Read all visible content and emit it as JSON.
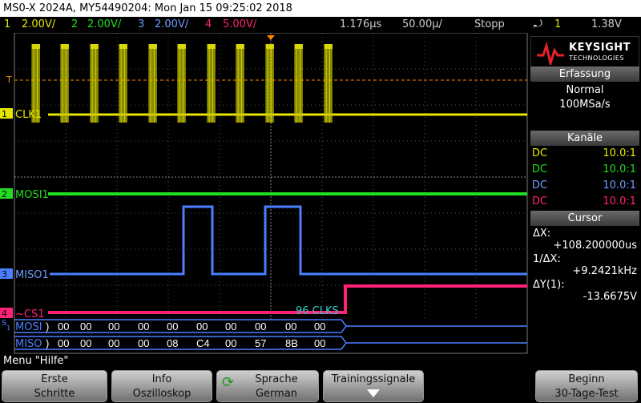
{
  "title": "MS0-X 2024A, MY54490204: Mon Jan 15 09:25:02 2018",
  "status": {
    "ch1_num": "1",
    "ch1_scale": "2.00V/",
    "ch2_num": "2",
    "ch2_scale": "2.00V/",
    "ch3_num": "3",
    "ch3_scale": "2.00V/",
    "ch4_num": "4",
    "ch4_scale": "5.00V/",
    "time_pos": "1.176μs",
    "time_base": "50.00μ/",
    "run_state": "Stopp",
    "trigger_icon": "trigger-edge-icon",
    "trigger_ch": "1",
    "trigger_level": "1.38V"
  },
  "colors": {
    "ch1": "#e6e600",
    "ch2": "#22dd22",
    "ch3": "#4a7fff",
    "ch4": "#ff2277",
    "decode": "#33cccc"
  },
  "waveforms": {
    "ch1_label": "CLK1",
    "ch2_label": "MOSI1",
    "ch3_label": "MISO1",
    "ch4_label": "~CS1",
    "marker_1": "1",
    "marker_2": "2",
    "marker_3": "3",
    "marker_4": "4",
    "trig_marker": "T",
    "decode_count": "96 CLKS",
    "bus_mosi_label": "MOSI",
    "bus_miso_label": "MISO",
    "bus_s": "S",
    "bus_1": "1",
    "mosi_values": [
      ")",
      "00",
      "00",
      "00",
      "00",
      "00",
      "00",
      "00",
      "00",
      "00",
      "00"
    ],
    "miso_values": [
      ")",
      "00",
      "00",
      "00",
      "00",
      "08",
      "C4",
      "00",
      "57",
      "8B",
      "00"
    ]
  },
  "panel": {
    "brand": "KEYSIGHT",
    "brand_sub": "TECHNOLOGIES",
    "acq_title": "Erfassung",
    "acq_mode": "Normal",
    "acq_rate": "100MSa/s",
    "channels_title": "Kanäle",
    "channels": [
      {
        "coupling": "DC",
        "probe": "10.0:1"
      },
      {
        "coupling": "DC",
        "probe": "10.0:1"
      },
      {
        "coupling": "DC",
        "probe": "10.0:1"
      },
      {
        "coupling": "DC",
        "probe": "10.0:1"
      }
    ],
    "cursor_title": "Cursor",
    "dx_label": "ΔX:",
    "dx_value": "+108.200000us",
    "inv_dx_label": "1/ΔX:",
    "inv_dx_value": "+9.2421kHz",
    "dy_label": "ΔY(1):",
    "dy_value": "-13.6675V"
  },
  "menu": {
    "label": "Menu \"Hilfe\"",
    "keys": [
      {
        "line1": "Erste",
        "line2": "Schritte"
      },
      {
        "line1": "Info",
        "line2": "Oszilloskop"
      },
      {
        "line1": "Sprache",
        "line2": "German"
      },
      {
        "line1": "Trainingssignale",
        "line2": ""
      },
      {
        "line1": "Beginn",
        "line2": "30-Tage-Test"
      }
    ]
  }
}
